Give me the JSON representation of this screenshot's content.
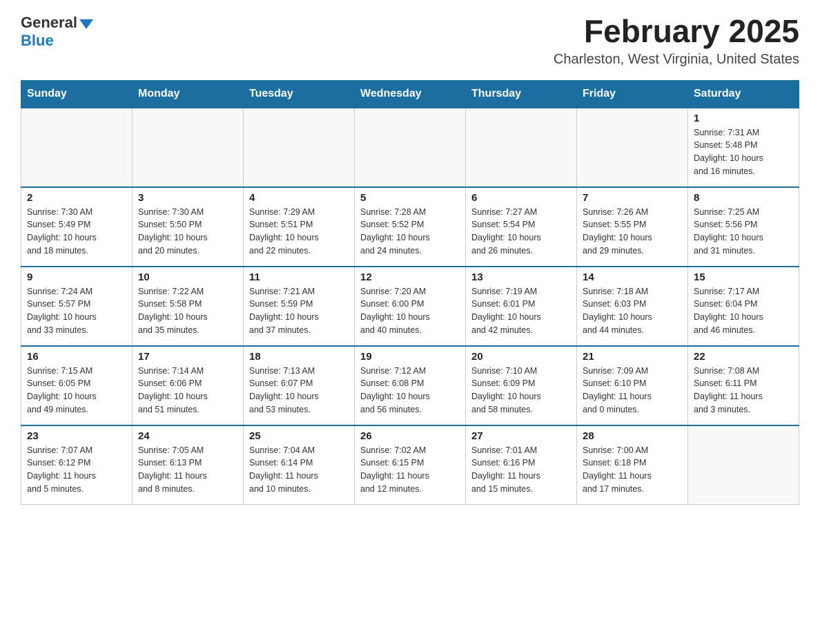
{
  "logo": {
    "general": "General",
    "blue": "Blue"
  },
  "header": {
    "title": "February 2025",
    "subtitle": "Charleston, West Virginia, United States"
  },
  "weekdays": [
    "Sunday",
    "Monday",
    "Tuesday",
    "Wednesday",
    "Thursday",
    "Friday",
    "Saturday"
  ],
  "weeks": [
    [
      {
        "day": "",
        "info": ""
      },
      {
        "day": "",
        "info": ""
      },
      {
        "day": "",
        "info": ""
      },
      {
        "day": "",
        "info": ""
      },
      {
        "day": "",
        "info": ""
      },
      {
        "day": "",
        "info": ""
      },
      {
        "day": "1",
        "info": "Sunrise: 7:31 AM\nSunset: 5:48 PM\nDaylight: 10 hours\nand 16 minutes."
      }
    ],
    [
      {
        "day": "2",
        "info": "Sunrise: 7:30 AM\nSunset: 5:49 PM\nDaylight: 10 hours\nand 18 minutes."
      },
      {
        "day": "3",
        "info": "Sunrise: 7:30 AM\nSunset: 5:50 PM\nDaylight: 10 hours\nand 20 minutes."
      },
      {
        "day": "4",
        "info": "Sunrise: 7:29 AM\nSunset: 5:51 PM\nDaylight: 10 hours\nand 22 minutes."
      },
      {
        "day": "5",
        "info": "Sunrise: 7:28 AM\nSunset: 5:52 PM\nDaylight: 10 hours\nand 24 minutes."
      },
      {
        "day": "6",
        "info": "Sunrise: 7:27 AM\nSunset: 5:54 PM\nDaylight: 10 hours\nand 26 minutes."
      },
      {
        "day": "7",
        "info": "Sunrise: 7:26 AM\nSunset: 5:55 PM\nDaylight: 10 hours\nand 29 minutes."
      },
      {
        "day": "8",
        "info": "Sunrise: 7:25 AM\nSunset: 5:56 PM\nDaylight: 10 hours\nand 31 minutes."
      }
    ],
    [
      {
        "day": "9",
        "info": "Sunrise: 7:24 AM\nSunset: 5:57 PM\nDaylight: 10 hours\nand 33 minutes."
      },
      {
        "day": "10",
        "info": "Sunrise: 7:22 AM\nSunset: 5:58 PM\nDaylight: 10 hours\nand 35 minutes."
      },
      {
        "day": "11",
        "info": "Sunrise: 7:21 AM\nSunset: 5:59 PM\nDaylight: 10 hours\nand 37 minutes."
      },
      {
        "day": "12",
        "info": "Sunrise: 7:20 AM\nSunset: 6:00 PM\nDaylight: 10 hours\nand 40 minutes."
      },
      {
        "day": "13",
        "info": "Sunrise: 7:19 AM\nSunset: 6:01 PM\nDaylight: 10 hours\nand 42 minutes."
      },
      {
        "day": "14",
        "info": "Sunrise: 7:18 AM\nSunset: 6:03 PM\nDaylight: 10 hours\nand 44 minutes."
      },
      {
        "day": "15",
        "info": "Sunrise: 7:17 AM\nSunset: 6:04 PM\nDaylight: 10 hours\nand 46 minutes."
      }
    ],
    [
      {
        "day": "16",
        "info": "Sunrise: 7:15 AM\nSunset: 6:05 PM\nDaylight: 10 hours\nand 49 minutes."
      },
      {
        "day": "17",
        "info": "Sunrise: 7:14 AM\nSunset: 6:06 PM\nDaylight: 10 hours\nand 51 minutes."
      },
      {
        "day": "18",
        "info": "Sunrise: 7:13 AM\nSunset: 6:07 PM\nDaylight: 10 hours\nand 53 minutes."
      },
      {
        "day": "19",
        "info": "Sunrise: 7:12 AM\nSunset: 6:08 PM\nDaylight: 10 hours\nand 56 minutes."
      },
      {
        "day": "20",
        "info": "Sunrise: 7:10 AM\nSunset: 6:09 PM\nDaylight: 10 hours\nand 58 minutes."
      },
      {
        "day": "21",
        "info": "Sunrise: 7:09 AM\nSunset: 6:10 PM\nDaylight: 11 hours\nand 0 minutes."
      },
      {
        "day": "22",
        "info": "Sunrise: 7:08 AM\nSunset: 6:11 PM\nDaylight: 11 hours\nand 3 minutes."
      }
    ],
    [
      {
        "day": "23",
        "info": "Sunrise: 7:07 AM\nSunset: 6:12 PM\nDaylight: 11 hours\nand 5 minutes."
      },
      {
        "day": "24",
        "info": "Sunrise: 7:05 AM\nSunset: 6:13 PM\nDaylight: 11 hours\nand 8 minutes."
      },
      {
        "day": "25",
        "info": "Sunrise: 7:04 AM\nSunset: 6:14 PM\nDaylight: 11 hours\nand 10 minutes."
      },
      {
        "day": "26",
        "info": "Sunrise: 7:02 AM\nSunset: 6:15 PM\nDaylight: 11 hours\nand 12 minutes."
      },
      {
        "day": "27",
        "info": "Sunrise: 7:01 AM\nSunset: 6:16 PM\nDaylight: 11 hours\nand 15 minutes."
      },
      {
        "day": "28",
        "info": "Sunrise: 7:00 AM\nSunset: 6:18 PM\nDaylight: 11 hours\nand 17 minutes."
      },
      {
        "day": "",
        "info": ""
      }
    ]
  ]
}
